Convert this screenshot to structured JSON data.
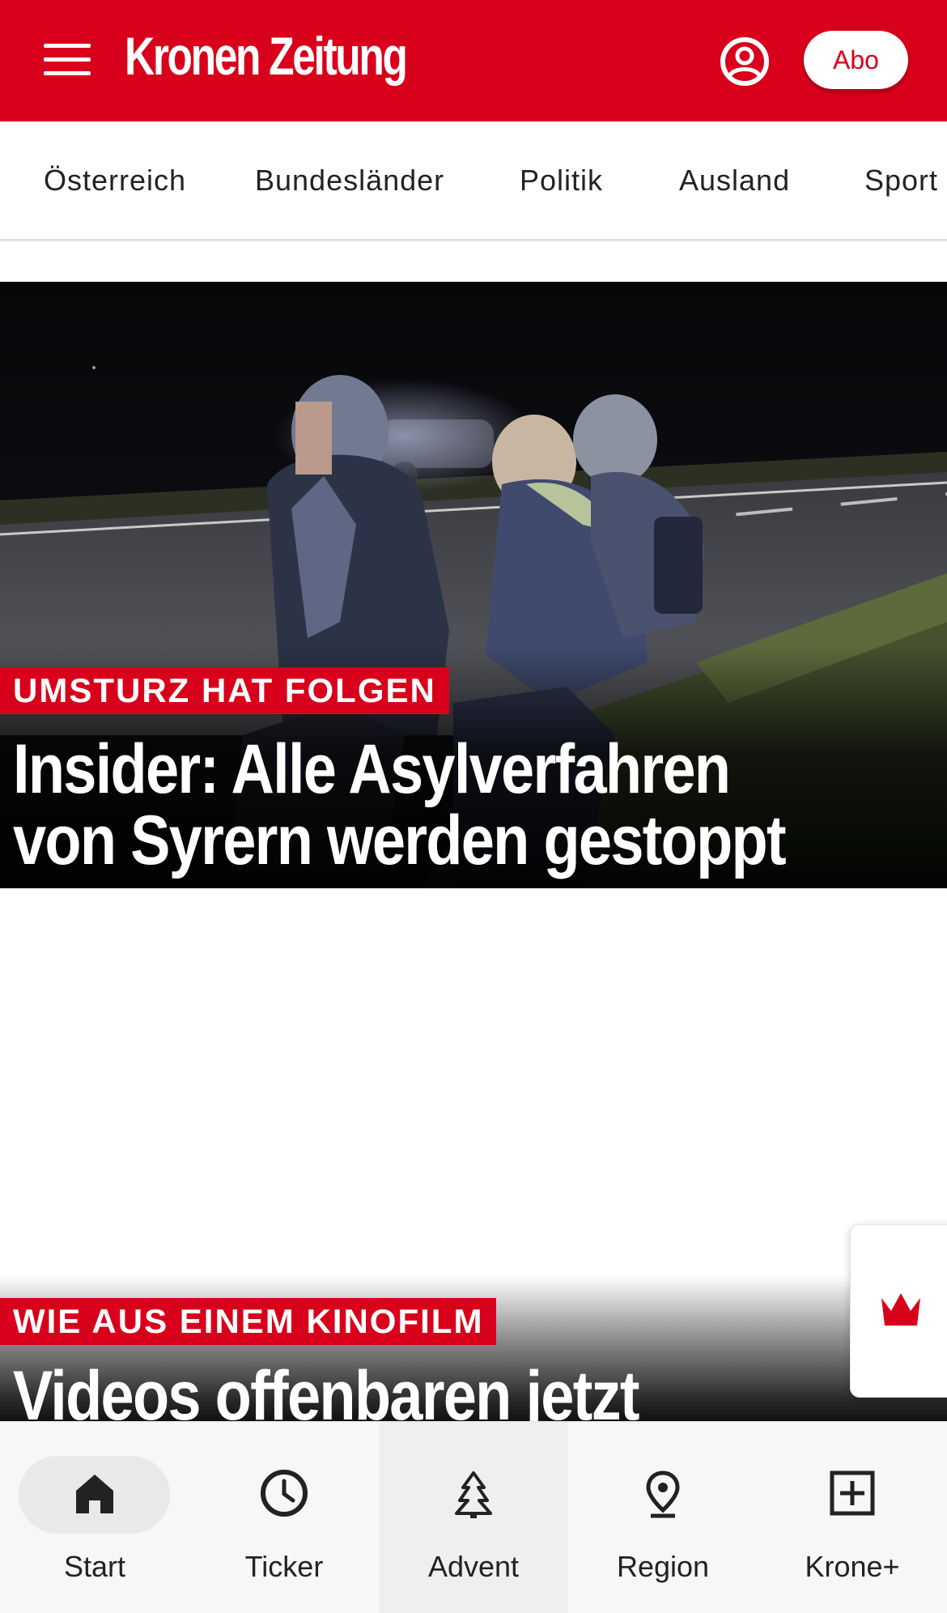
{
  "header": {
    "logo": "Kronen Zeitung",
    "abo_label": "Abo",
    "brand_color": "#d9001b"
  },
  "nav": {
    "categories": [
      "Österreich",
      "Bundesländer",
      "Politik",
      "Ausland",
      "Sport"
    ]
  },
  "articles": [
    {
      "kicker": "UMSTURZ HAT FOLGEN",
      "headline_line1": "Insider: Alle Asylverfahren",
      "headline_line2": "von Syrern werden gestoppt"
    },
    {
      "kicker": "WIE AUS EINEM KINOFILM",
      "headline_line1": "Videos offenbaren jetzt"
    }
  ],
  "bottom_nav": {
    "tabs": [
      {
        "label": "Start",
        "icon": "home-icon",
        "active": true
      },
      {
        "label": "Ticker",
        "icon": "clock-icon"
      },
      {
        "label": "Advent",
        "icon": "tree-icon"
      },
      {
        "label": "Region",
        "icon": "location-pin-icon"
      },
      {
        "label": "Krone+",
        "icon": "plus-box-icon"
      }
    ]
  },
  "icons": {
    "menu": "menu-icon",
    "account": "account-icon",
    "crown": "crown-icon"
  }
}
